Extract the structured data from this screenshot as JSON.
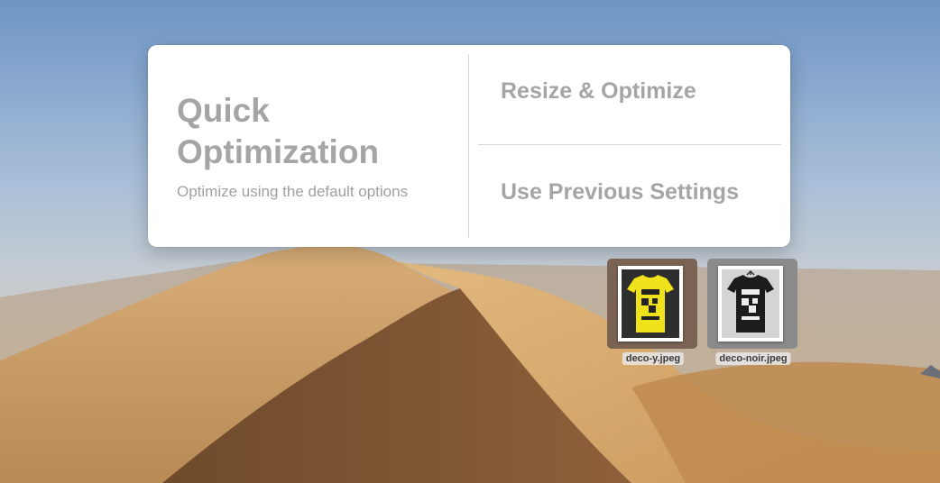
{
  "panel": {
    "quick_title": "Quick Optimization",
    "quick_subtitle": "Optimize using the default options",
    "resize_label": "Resize & Optimize",
    "previous_label": "Use Previous Settings"
  },
  "files": [
    {
      "name": "deco-y.jpeg",
      "shirt_color": "#f0e21a",
      "bg_color": "#7a6352"
    },
    {
      "name": "deco-noir.jpeg",
      "shirt_color": "#1c1c1c",
      "bg_color": "#8a8a8a"
    }
  ],
  "colors": {
    "accent_text": "#a5a5a5",
    "sky": "#7fa0c9",
    "sand": "#c99a62"
  }
}
